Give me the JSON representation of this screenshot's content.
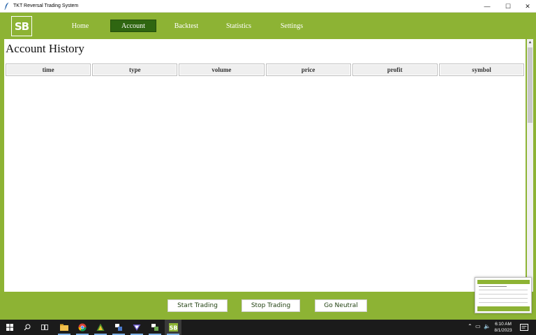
{
  "window": {
    "title": "TKT Reversal Trading System",
    "controls": {
      "minimize": "—",
      "maximize": "☐",
      "close": "✕"
    }
  },
  "colors": {
    "brand_green": "#8db334",
    "nav_active": "#2f6611",
    "button_text": "#1d3d0d",
    "taskbar": "#1b1b1b"
  },
  "logo": {
    "text": "SB"
  },
  "nav": {
    "items": [
      {
        "label": "Home",
        "active": false
      },
      {
        "label": "Account",
        "active": true
      },
      {
        "label": "Backtest",
        "active": false
      },
      {
        "label": "Statistics",
        "active": false
      },
      {
        "label": "Settings",
        "active": false
      }
    ]
  },
  "main": {
    "title": "Account History",
    "table": {
      "columns": [
        "time",
        "type",
        "volume",
        "price",
        "profit",
        "symbol"
      ],
      "rows": []
    }
  },
  "actions": {
    "start_label": "Start Trading",
    "stop_label": "Stop Trading",
    "neutral_label": "Go Neutral"
  },
  "taskbar": {
    "pinned": [
      "windows-start-icon",
      "search-icon",
      "task-view-icon",
      "file-explorer-icon",
      "chrome-icon",
      "metatrader-icon",
      "app-icon",
      "vpn-icon",
      "app-icon",
      "tkt-app-icon"
    ],
    "tray": {
      "time": "6:10 AM",
      "date": "8/1/2023"
    }
  }
}
